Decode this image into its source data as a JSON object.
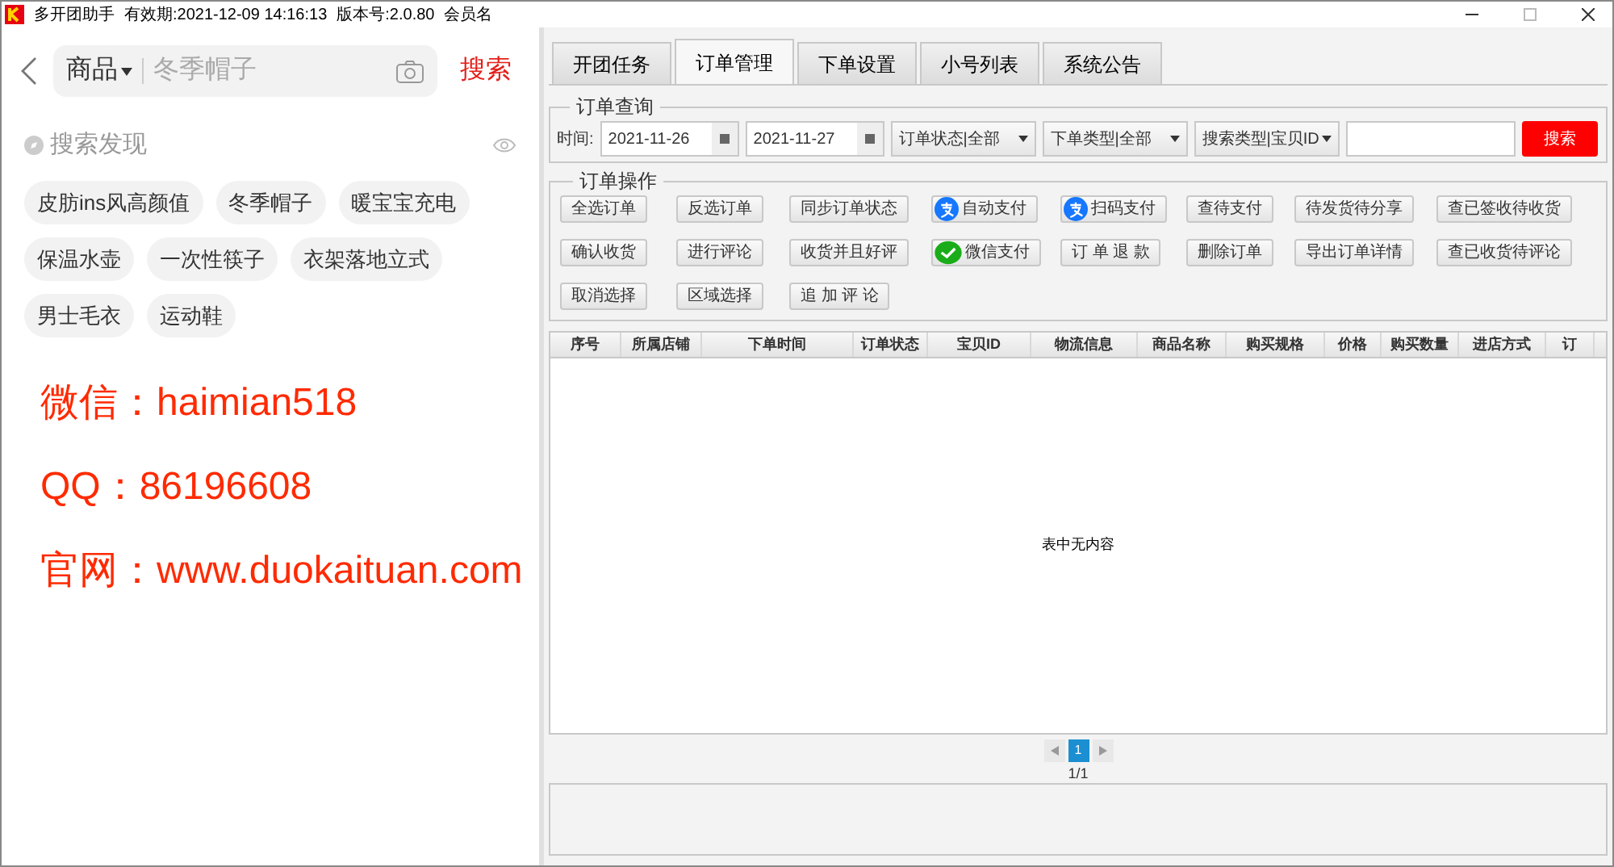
{
  "window": {
    "title": "多开团助手",
    "validity": "有效期:2021-12-09 14:16:13",
    "version": "版本号:2.0.80",
    "member": "会员名"
  },
  "left": {
    "search": {
      "category": "商品",
      "placeholder": "冬季帽子",
      "button": "搜索"
    },
    "discover_title": "搜索发现",
    "tags": [
      "皮肪ins风高颜值",
      "冬季帽子",
      "暖宝宝充电",
      "保温水壶",
      "一次性筷子",
      "衣架落地立式",
      "男士毛衣",
      "运动鞋"
    ],
    "promo": [
      "微信：haimian518",
      "QQ：86196608",
      "官网：www.duokaituan.com"
    ]
  },
  "tabs": [
    {
      "label": "开团任务",
      "selected": false
    },
    {
      "label": "订单管理",
      "selected": true
    },
    {
      "label": "下单设置",
      "selected": false
    },
    {
      "label": "小号列表",
      "selected": false
    },
    {
      "label": "系统公告",
      "selected": false
    }
  ],
  "query": {
    "legend": "订单查询",
    "time_label": "时间:",
    "date_from": "2021-11-26",
    "date_to": "2021-11-27",
    "selects": [
      "订单状态|全部",
      "下单类型|全部",
      "搜索类型|宝贝ID"
    ],
    "search_button": "搜索"
  },
  "operations": {
    "legend": "订单操作",
    "rows": [
      [
        {
          "label": "全选订单",
          "kind": "plain"
        },
        {
          "label": "反选订单",
          "kind": "plain"
        },
        {
          "label": "同步订单状态",
          "kind": "plain"
        },
        {
          "label": "自动支付",
          "kind": "alipay"
        },
        {
          "label": "扫码支付",
          "kind": "alipay"
        },
        {
          "label": "查待支付",
          "kind": "plain"
        },
        {
          "label": "待发货待分享",
          "kind": "plain"
        },
        {
          "label": "查已签收待收货",
          "kind": "plain"
        }
      ],
      [
        {
          "label": "确认收货",
          "kind": "plain"
        },
        {
          "label": "进行评论",
          "kind": "plain"
        },
        {
          "label": "收货并且好评",
          "kind": "plain"
        },
        {
          "label": "微信支付",
          "kind": "wechat"
        },
        {
          "label": "订 单 退 款",
          "kind": "plain"
        },
        {
          "label": "删除订单",
          "kind": "plain"
        },
        {
          "label": "导出订单详情",
          "kind": "plain"
        },
        {
          "label": "查已收货待评论",
          "kind": "plain"
        }
      ],
      [
        {
          "label": "取消选择",
          "kind": "plain"
        },
        {
          "label": "区域选择",
          "kind": "plain"
        },
        {
          "label": "追 加 评 论",
          "kind": "plain"
        }
      ]
    ]
  },
  "table": {
    "columns": [
      "序号",
      "所属店铺",
      "下单时间",
      "订单状态",
      "宝贝ID",
      "物流信息",
      "商品名称",
      "购买规格",
      "价格",
      "购买数量",
      "进店方式",
      "订"
    ],
    "empty_text": "表中无内容"
  },
  "pagination": {
    "pages": [
      {
        "label": "1",
        "selected": true
      }
    ],
    "summary": "1/1"
  }
}
